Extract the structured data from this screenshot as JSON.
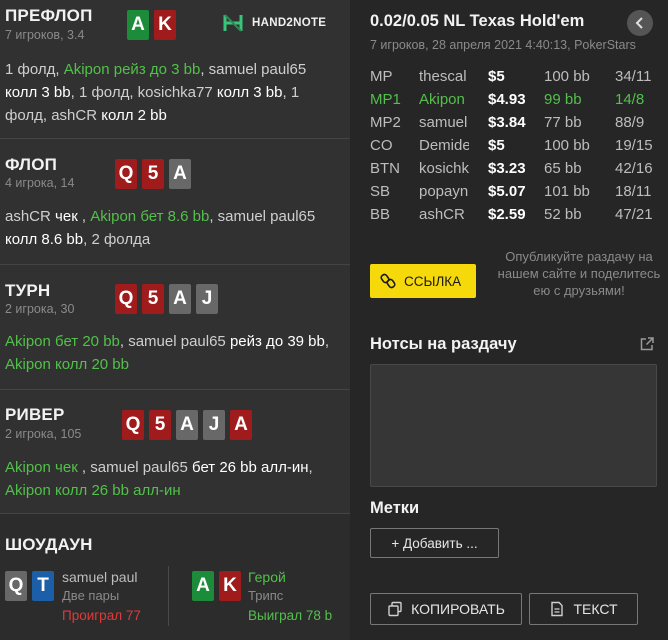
{
  "streets": {
    "preflop": {
      "title": "ПРЕФЛОП",
      "sub": "7 игроков, 3.4",
      "cards": [
        "A",
        "K"
      ],
      "t1": "1 фолд, ",
      "t2": "Akipon рейз до 3 bb",
      "t3": ", samuel paul65 ",
      "t4": "колл 3 bb",
      "t5": ", 1 фолд, kosichka77 ",
      "t6": "колл 3 bb",
      "t7": ", 1 фолд, ashCR ",
      "t8": "колл 2 bb"
    },
    "flop": {
      "title": "ФЛОП",
      "sub": "4 игрока, 14",
      "cards": [
        "Q",
        "5",
        "A"
      ],
      "t1": "ashCR ",
      "t2": "чек",
      "t3": " , ",
      "t4": "Akipon бет 8.6 bb",
      "t5": ", samuel paul65 ",
      "t6": "колл 8.6 bb",
      "t7": ", 2 фолда"
    },
    "turn": {
      "title": "ТУРН",
      "sub": "2 игрока, 30",
      "cards": [
        "Q",
        "5",
        "A",
        "J"
      ],
      "t1": "Akipon бет 20 bb",
      "t2": ", samuel paul65 ",
      "t3": "рейз до 39 bb",
      "t4": ", ",
      "t5": "Akipon колл 20 bb"
    },
    "river": {
      "title": "РИВЕР",
      "sub": "2 игрока, 105",
      "cards": [
        "Q",
        "5",
        "A",
        "J",
        "A"
      ],
      "t1": "Akipon чек",
      "t2": " , samuel paul65 ",
      "t3": "бет 26 bb алл-ин",
      "t4": ", ",
      "t5": "Akipon колл 26 bb алл-ин"
    },
    "showdown": {
      "title": "ШОУДАУН",
      "p1": {
        "cards": [
          "Q",
          "T"
        ],
        "name": "samuel paul",
        "hand": "Две пары",
        "result": "Проиграл 77"
      },
      "p2": {
        "cards": [
          "A",
          "K"
        ],
        "name": "Герой",
        "hand": "Трипс",
        "result": "Выиграл 78 b"
      }
    }
  },
  "logo": {
    "text": "HAND2NOTE"
  },
  "header": {
    "title": "0.02/0.05 NL Texas Hold'em",
    "sub": "7 игроков, 28 апреля 2021 4:40:13, PokerStars",
    "back_icon": "chevron-left-icon"
  },
  "players": [
    {
      "pos": "MP",
      "name": "thescal",
      "stack": "$5",
      "bb": "100 bb",
      "stat": "34/11"
    },
    {
      "pos": "MP1",
      "name": "Akipon",
      "stack": "$4.93",
      "bb": "99 bb",
      "stat": "14/8"
    },
    {
      "pos": "MP2",
      "name": "samuel",
      "stack": "$3.84",
      "bb": "77 bb",
      "stat": "88/9"
    },
    {
      "pos": "CO",
      "name": "Demide",
      "stack": "$5",
      "bb": "100 bb",
      "stat": "19/15"
    },
    {
      "pos": "BTN",
      "name": "kosichk",
      "stack": "$3.23",
      "bb": "65 bb",
      "stat": "42/16"
    },
    {
      "pos": "SB",
      "name": "popayn",
      "stack": "$5.07",
      "bb": "101 bb",
      "stat": "18/11"
    },
    {
      "pos": "BB",
      "name": "ashCR",
      "stack": "$2.59",
      "bb": "52 bb",
      "stat": "47/21"
    }
  ],
  "share": {
    "link_label": "ССЫЛКА",
    "note": "Опубликуйте раздачу на нашем сайте и поделитесь ею с друзьями!"
  },
  "notes": {
    "title": "Нотсы на раздачу",
    "placeholder": ""
  },
  "tags": {
    "title": "Метки",
    "add_label": "+ Добавить ..."
  },
  "actions": {
    "copy_label": "КОПИРОВАТЬ",
    "text_label": "ТЕКСТ"
  },
  "colors": {
    "green": "#52c04a",
    "card_red": "#a01c1c",
    "card_green": "#1c8c3a",
    "card_blue": "#1a5fa8",
    "card_gray": "#686868",
    "accent_yellow": "#f5d90a"
  }
}
